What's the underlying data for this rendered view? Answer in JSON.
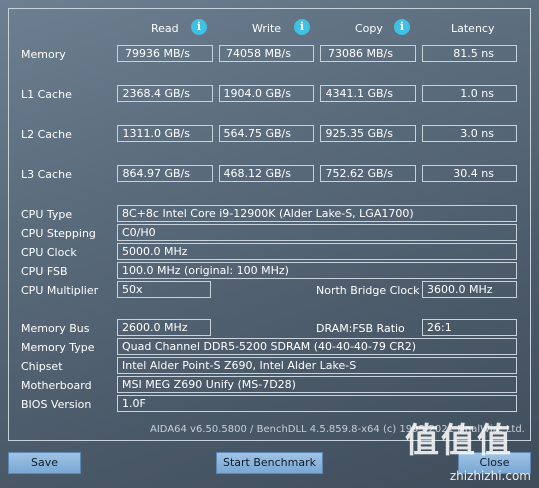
{
  "headers": {
    "read": "Read",
    "write": "Write",
    "copy": "Copy",
    "latency": "Latency"
  },
  "info_glyph": "i",
  "rows": {
    "memory": {
      "label": "Memory",
      "read": "79936 MB/s",
      "write": "74058 MB/s",
      "copy": "73086 MB/s",
      "latency": "81.5 ns"
    },
    "l1": {
      "label": "L1 Cache",
      "read": "2368.4 GB/s",
      "write": "1904.0 GB/s",
      "copy": "4341.1 GB/s",
      "latency": "1.0 ns"
    },
    "l2": {
      "label": "L2 Cache",
      "read": "1311.0 GB/s",
      "write": "564.75 GB/s",
      "copy": "925.35 GB/s",
      "latency": "3.0 ns"
    },
    "l3": {
      "label": "L3 Cache",
      "read": "864.97 GB/s",
      "write": "468.12 GB/s",
      "copy": "752.62 GB/s",
      "latency": "30.4 ns"
    }
  },
  "cpu": {
    "type_label": "CPU Type",
    "type_value": "8C+8c Intel Core i9-12900K  (Alder Lake-S, LGA1700)",
    "stepping_label": "CPU Stepping",
    "stepping_value": "C0/H0",
    "clock_label": "CPU Clock",
    "clock_value": "5000.0 MHz",
    "fsb_label": "CPU FSB",
    "fsb_value": "100.0 MHz  (original: 100 MHz)",
    "multiplier_label": "CPU Multiplier",
    "multiplier_value": "50x",
    "nb_clock_label": "North Bridge Clock",
    "nb_clock_value": "3600.0 MHz"
  },
  "memory": {
    "bus_label": "Memory Bus",
    "bus_value": "2600.0 MHz",
    "ratio_label": "DRAM:FSB Ratio",
    "ratio_value": "26:1",
    "type_label": "Memory Type",
    "type_value": "Quad Channel DDR5-5200 SDRAM  (40-40-40-79 CR2)",
    "chipset_label": "Chipset",
    "chipset_value": "Intel Alder Point-S Z690, Intel Alder Lake-S",
    "motherboard_label": "Motherboard",
    "motherboard_value": "MSI MEG Z690 Unify (MS-7D28)",
    "bios_label": "BIOS Version",
    "bios_value": "1.0F"
  },
  "footer": "AIDA64 v6.50.5800 / BenchDLL 4.5.859.8-x64  (c) 1995-2021 FinalWire Ltd.",
  "buttons": {
    "save": "Save",
    "benchmark": "Start Benchmark",
    "close": "Close"
  },
  "watermark": {
    "chars": "值值值",
    "url": "zhizhizhi.com"
  }
}
